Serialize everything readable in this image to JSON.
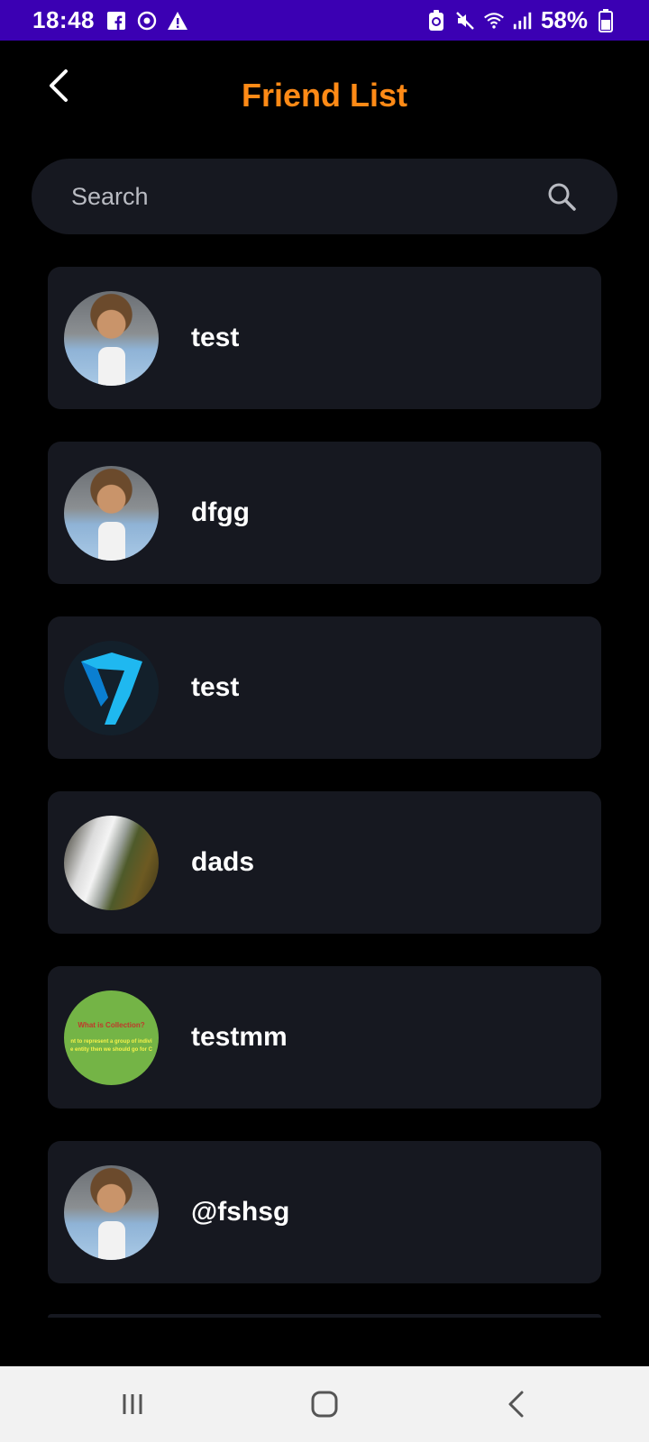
{
  "status_bar": {
    "time": "18:48",
    "battery": "58%"
  },
  "header": {
    "title": "Friend List"
  },
  "search": {
    "placeholder": "Search"
  },
  "friends": [
    {
      "name": "test",
      "avatar": "man-photo"
    },
    {
      "name": "dfgg",
      "avatar": "man-photo"
    },
    {
      "name": "test",
      "avatar": "blue-logo"
    },
    {
      "name": "dads",
      "avatar": "waterfall-photo"
    },
    {
      "name": "testmm",
      "avatar": "collection-slide"
    },
    {
      "name": "@fshsg",
      "avatar": "man-photo"
    }
  ],
  "collection_slide": {
    "line1": "What is Collection?",
    "line2": "nt to represent a group of indivi",
    "line3": "e entity then we should go for C"
  },
  "colors": {
    "status_bar": "#3b00b3",
    "title": "#ff8a16",
    "card": "#161820",
    "background": "#000000"
  }
}
